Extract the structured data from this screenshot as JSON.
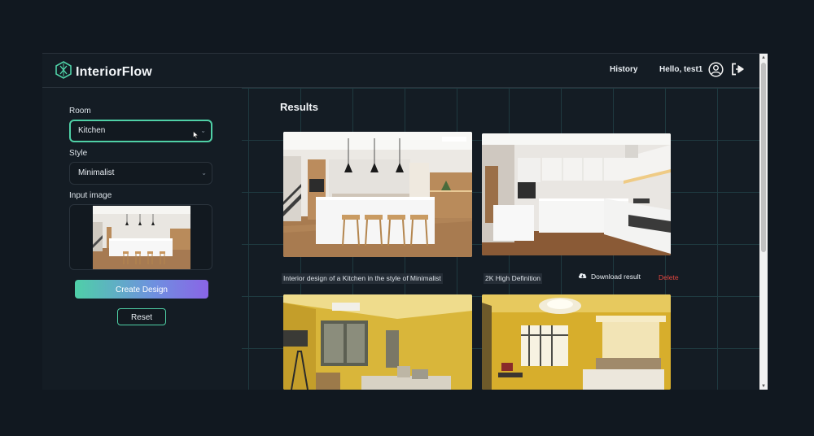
{
  "app": {
    "name": "InteriorFlow"
  },
  "nav": {
    "history": "History",
    "greeting": "Hello, test1"
  },
  "sidebar": {
    "room": {
      "label": "Room",
      "value": "Kitchen"
    },
    "style": {
      "label": "Style",
      "value": "Minimalist"
    },
    "input_image": {
      "label": "Input image"
    },
    "create_button": "Create Design",
    "reset_button": "Reset"
  },
  "results": {
    "title": "Results",
    "items": [
      {
        "prompt": "Interior design of a Kitchen in the style of Minimalist",
        "quality": "2K High Definition",
        "download": "Download result",
        "delete": "Delete"
      }
    ]
  },
  "colors": {
    "accent": "#4fd0a6",
    "gradient_start": "#4fcfa8",
    "gradient_end": "#8a64e6",
    "delete": "#e0453e",
    "background": "#141c24"
  },
  "icons": [
    "logo-icon",
    "user-icon",
    "logout-icon",
    "chevron-down-icon",
    "cloud-download-icon",
    "cursor-icon"
  ]
}
